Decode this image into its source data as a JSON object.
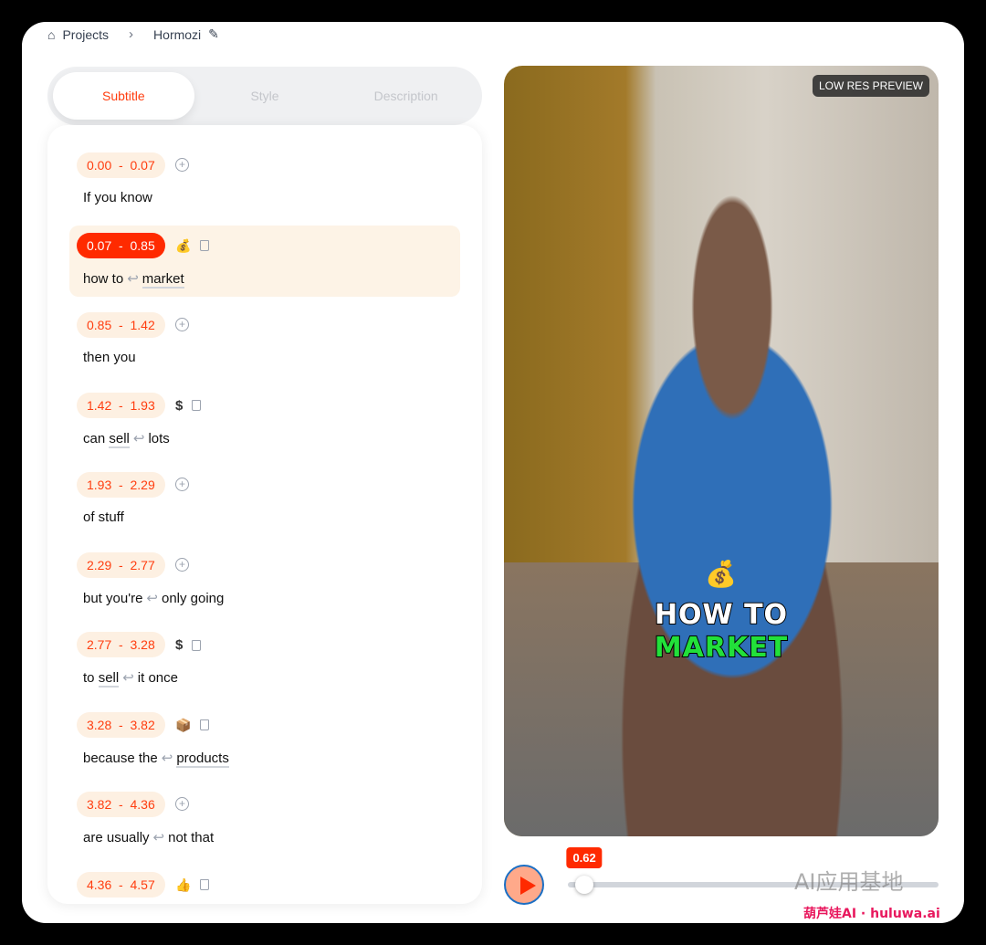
{
  "breadcrumb": {
    "home_icon": "home-icon",
    "projects": "Projects",
    "project_name": "Hormozi",
    "edit_icon": "pencil-icon"
  },
  "tabs": [
    {
      "label": "Subtitle",
      "active": true
    },
    {
      "label": "Style",
      "active": false
    },
    {
      "label": "Description",
      "active": false
    }
  ],
  "accent": "#ff2a00",
  "segments": [
    {
      "start": "0.00",
      "end": "0.07",
      "emoji": null,
      "tokens": [
        {
          "t": "If you know"
        }
      ]
    },
    {
      "start": "0.07",
      "end": "0.85",
      "emoji": "💰",
      "active": true,
      "tokens": [
        {
          "t": "how to"
        },
        {
          "br": "↩"
        },
        {
          "t": "market",
          "kw": true
        }
      ]
    },
    {
      "start": "0.85",
      "end": "1.42",
      "emoji": null,
      "tokens": [
        {
          "t": "then you"
        }
      ]
    },
    {
      "start": "1.42",
      "end": "1.93",
      "emoji": "$",
      "tokens": [
        {
          "t": "can "
        },
        {
          "t": "sell",
          "kw": true
        },
        {
          "br": "↩"
        },
        {
          "t": "lots"
        }
      ]
    },
    {
      "start": "1.93",
      "end": "2.29",
      "emoji": null,
      "tokens": [
        {
          "t": "of stuff"
        }
      ]
    },
    {
      "start": "2.29",
      "end": "2.77",
      "emoji": null,
      "tokens": [
        {
          "t": "but you're"
        },
        {
          "br": "↩"
        },
        {
          "t": "only going"
        }
      ]
    },
    {
      "start": "2.77",
      "end": "3.28",
      "emoji": "$",
      "tokens": [
        {
          "t": "to "
        },
        {
          "t": "sell",
          "kw": true
        },
        {
          "br": "↩"
        },
        {
          "t": "it once"
        }
      ]
    },
    {
      "start": "3.28",
      "end": "3.82",
      "emoji": "📦",
      "tokens": [
        {
          "t": "because the"
        },
        {
          "br": "↩"
        },
        {
          "t": "products",
          "kw": true
        }
      ]
    },
    {
      "start": "3.82",
      "end": "4.36",
      "emoji": null,
      "tokens": [
        {
          "t": "are usually"
        },
        {
          "br": "↩"
        },
        {
          "t": "not that"
        }
      ]
    },
    {
      "start": "4.36",
      "end": "4.57",
      "emoji": "👍",
      "tokens": []
    }
  ],
  "preview": {
    "badge": "LOW RES PREVIEW",
    "caption_emoji": "💰",
    "caption_line1": "HOW TO",
    "caption_line2": "MARKET",
    "caption_colors": [
      "#ffffff",
      "#22e03a"
    ]
  },
  "player": {
    "current_time": "0.62",
    "progress_fraction": 0.02
  },
  "watermark": {
    "line1": "AI应用基地",
    "line2": "葫芦娃AI · huluwa.ai"
  }
}
